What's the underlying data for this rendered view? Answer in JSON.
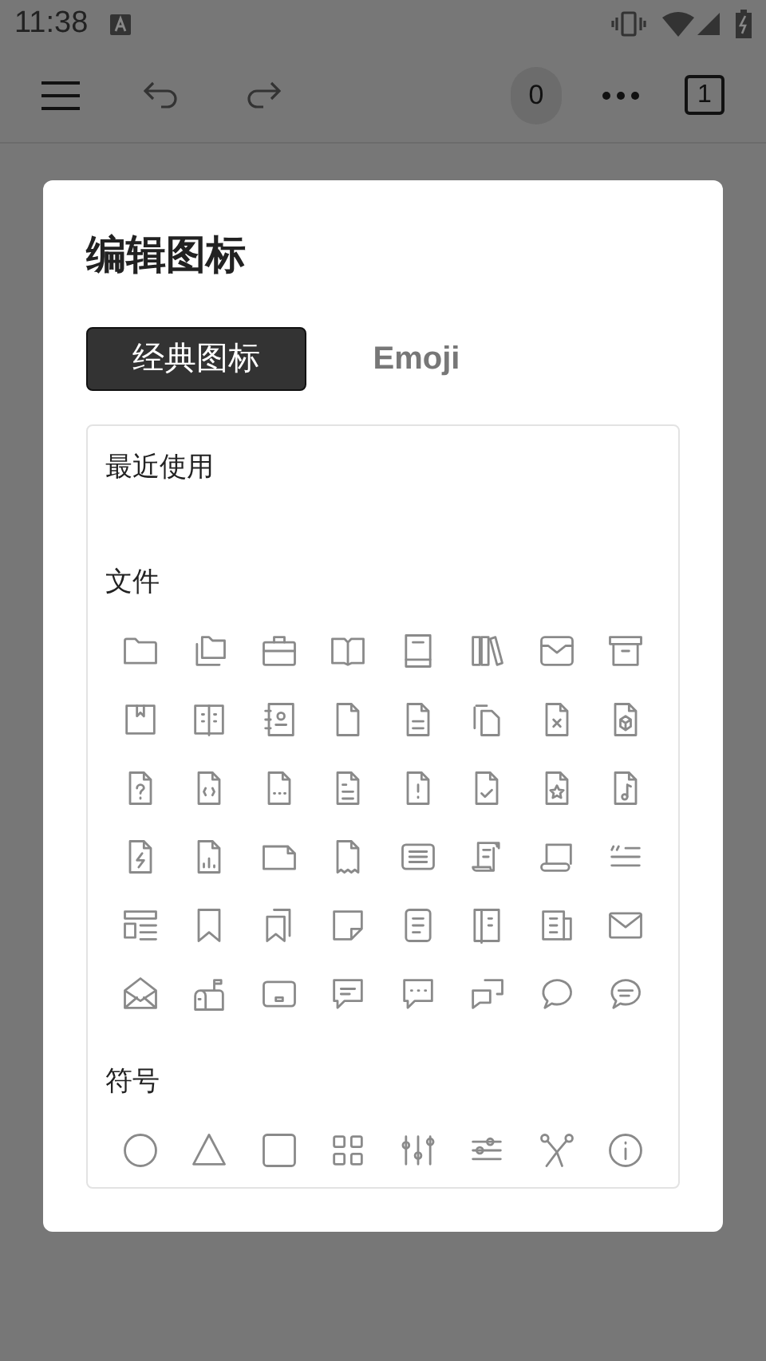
{
  "status_bar": {
    "time": "11:38"
  },
  "toolbar": {
    "counter": "0",
    "page": "1"
  },
  "dialog": {
    "title": "编辑图标",
    "tabs": [
      {
        "label": "经典图标",
        "selected": true
      },
      {
        "label": "Emoji",
        "selected": false
      }
    ],
    "sections": [
      {
        "title": "最近使用",
        "kind": "recent"
      },
      {
        "title": "文件",
        "kind": "files"
      },
      {
        "title": "符号",
        "kind": "symbols"
      }
    ]
  }
}
